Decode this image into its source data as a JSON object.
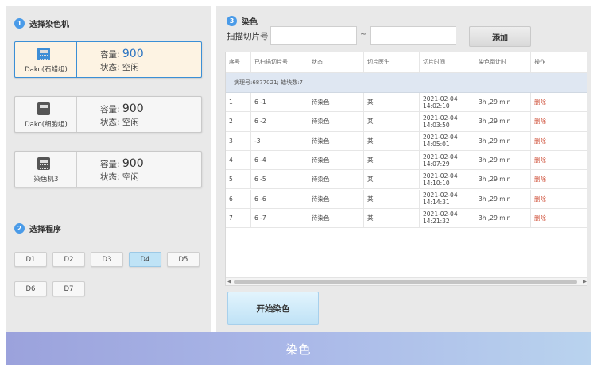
{
  "step1": {
    "num": "1",
    "title": "选择染色机"
  },
  "machines": [
    {
      "name": "Dako(石蜡组)",
      "capacity_label": "容量:",
      "capacity": "900",
      "status_label": "状态:",
      "status": "空闲",
      "active": true
    },
    {
      "name": "Dako(细胞组)",
      "capacity_label": "容量:",
      "capacity": "900",
      "status_label": "状态:",
      "status": "空闲",
      "active": false
    },
    {
      "name": "染色机3",
      "capacity_label": "容量:",
      "capacity": "900",
      "status_label": "状态:",
      "status": "空闲",
      "active": false
    }
  ],
  "step2": {
    "num": "2",
    "title": "选择程序"
  },
  "programs": [
    "D1",
    "D2",
    "D3",
    "D4",
    "D5",
    "D6",
    "D7"
  ],
  "selected_program": "D4",
  "step3": {
    "num": "3",
    "title": "染色"
  },
  "scan": {
    "label": "扫描切片号",
    "from_value": "",
    "to_value": "",
    "separator": "~",
    "add_label": "添加"
  },
  "table": {
    "headers": [
      "序号",
      "已扫描切片号",
      "状态",
      "切片医生",
      "切片时间",
      "染色倒计时",
      "操作"
    ],
    "group_label": "病理号:6877021; 蜡块数:7",
    "rows": [
      {
        "idx": "1",
        "slide": "6      -1",
        "status": "待染色",
        "doctor": "某",
        "time": "2021-02-04\n14:02:10",
        "countdown": "3h ,29 min",
        "op": "删除"
      },
      {
        "idx": "2",
        "slide": "6      -2",
        "status": "待染色",
        "doctor": "某",
        "time": "2021-02-04\n14:03:50",
        "countdown": "3h ,29 min",
        "op": "删除"
      },
      {
        "idx": "3",
        "slide": "      -3",
        "status": "待染色",
        "doctor": "某",
        "time": "2021-02-04\n14:05:01",
        "countdown": "3h ,29 min",
        "op": "删除"
      },
      {
        "idx": "4",
        "slide": "6      -4",
        "status": "待染色",
        "doctor": "某",
        "time": "2021-02-04\n14:07:29",
        "countdown": "3h ,29 min",
        "op": "删除"
      },
      {
        "idx": "5",
        "slide": "6      -5",
        "status": "待染色",
        "doctor": "某",
        "time": "2021-02-04\n14:10:10",
        "countdown": "3h ,29 min",
        "op": "删除"
      },
      {
        "idx": "6",
        "slide": "6      -6",
        "status": "待染色",
        "doctor": "某",
        "time": "2021-02-04\n14:14:31",
        "countdown": "3h ,29 min",
        "op": "删除"
      },
      {
        "idx": "7",
        "slide": "6      -7",
        "status": "待染色",
        "doctor": "某",
        "time": "2021-02-04\n14:21:32",
        "countdown": "3h ,29 min",
        "op": "删除"
      }
    ]
  },
  "start_label": "开始染色",
  "banner_title": "染色",
  "colors": {
    "accent": "#3b8fd6",
    "delete": "#d0533c",
    "selected_program": "#bfe3f6",
    "banner_start": "#9ba2dc",
    "banner_end": "#b9d3ee"
  }
}
